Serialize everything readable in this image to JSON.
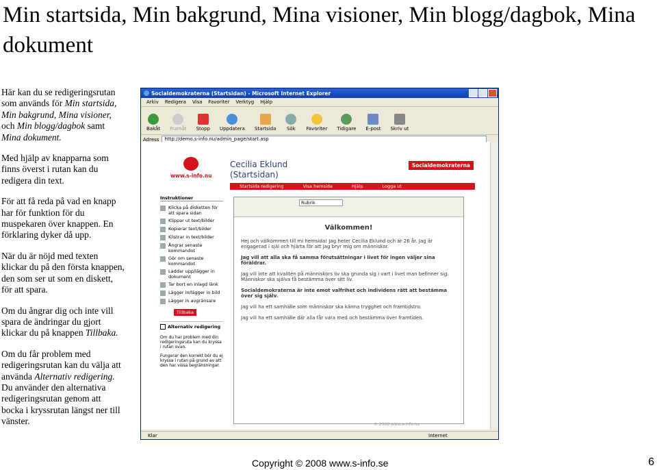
{
  "title": "Min startsida, Min bakgrund, Mina visioner, Min blogg/dagbok, Mina dokument",
  "paragraphs": {
    "p1_a": "Här kan du se redigeringsrutan som används för ",
    "p1_b": "Min startsida, Min bakgrund, Mina visioner,",
    "p1_c": " och ",
    "p1_d": "Min blogg/dagbok",
    "p1_e": " samt ",
    "p1_f": "Mina dokument.",
    "p2": "Med hjälp av knapparna som finns överst i rutan kan du redigera din text.",
    "p3": "För att få reda på vad en knapp har för funktion för du muspekaren över knappen. En förklaring dyker då upp.",
    "p4": "När du är nöjd med texten klickar du på den första knappen, den som ser ut som en diskett, för att spara.",
    "p5_a": "Om du ångrar dig och inte vill spara de ändringar du gjort klickar du på knappen ",
    "p5_b": "Tillbaka.",
    "p6_a": "Om du får problem med redigeringsrutan kan du välja att använda ",
    "p6_b": "Alternativ redigering.",
    "p6_c": " Du använder den alternativa redigeringsrutan genom att bocka i kryssrutan längst ner till vänster."
  },
  "footer": {
    "copyright": "Copyright © 2008 www.s-info.se",
    "page": "6"
  },
  "browser": {
    "window_title": "Socialdemokraterna (Startsidan) - Microsoft Internet Explorer",
    "menu": [
      "Arkiv",
      "Redigera",
      "Visa",
      "Favoriter",
      "Verktyg",
      "Hjälp"
    ],
    "toolbar": [
      "Bakåt",
      "Framåt",
      "Stopp",
      "Uppdatera",
      "Startsida",
      "Sök",
      "Favoriter",
      "Tidigare",
      "E-post",
      "Skriv ut"
    ],
    "address_label": "Adress",
    "address": "http://demo.s-info.nu/admin_page/start.asp",
    "status": "Klar",
    "zone": "Internet"
  },
  "site": {
    "url": "www.s-info.nu",
    "name": "Cecilia Eklund",
    "subtitle": "(Startsidan)",
    "brand": "Socialdemokraterna",
    "nav": [
      "Startsida redigering",
      "Visa hemsida",
      "Hjälp",
      "Logga ut"
    ],
    "instructions_title": "Instruktioner",
    "instructions": [
      "Klicka på disketten för att spara sidan",
      "Klippar ut text/bilder",
      "Kopierar text/bilder",
      "Klistrar in text/bilder",
      "Ångrar senaste kommandot",
      "Gör om senaste kommandot",
      "Laddar upp/lägger in dokument",
      "Tar bort en inlagd länk",
      "Lägger in/lägger in bild",
      "Lägger in avgränsare"
    ],
    "back_button": "Tillbaka",
    "alt_label": "Alternativ redigering",
    "help1": "Om du har problem med din redigeringsruta kan du kryssa i rutan ovan.",
    "help2": "Fungerar den korrekt bör du ej kryssa i rutan på grund av att den har vissa begränsningar.",
    "editor_font": "Rubrik",
    "welcome": "Välkommen!",
    "body": [
      "Hej och välkommen till mi hemsida! Jag heter Cecilia Eklund och är 26 år. Jag är engagerad i själ och hjärta för att jag bryr mig om människor.",
      "Jag vill att alla ska få samma förutsättningar i livet för ingen väljer sina föräldrar.",
      "Jag vill inte att kvalitén på människors liv ska grunda sig i vart i livet man befinner sig. Människor ska själva få bestämma över sitt liv.",
      "Socialdemokraterna är inte emot valfrihet och individens rätt att bestämma över sig själv.",
      "Jag vill ha ett samhälle som människor ska känna trygghet och framtidstro.",
      "Jag vill ha ett samhälle där alla får vara med och bestämma över framtiden."
    ],
    "copyright": "© 2008 www.s-info.nu"
  },
  "colors": {
    "accent": "#d4141a",
    "navy": "#2d3a7a"
  }
}
